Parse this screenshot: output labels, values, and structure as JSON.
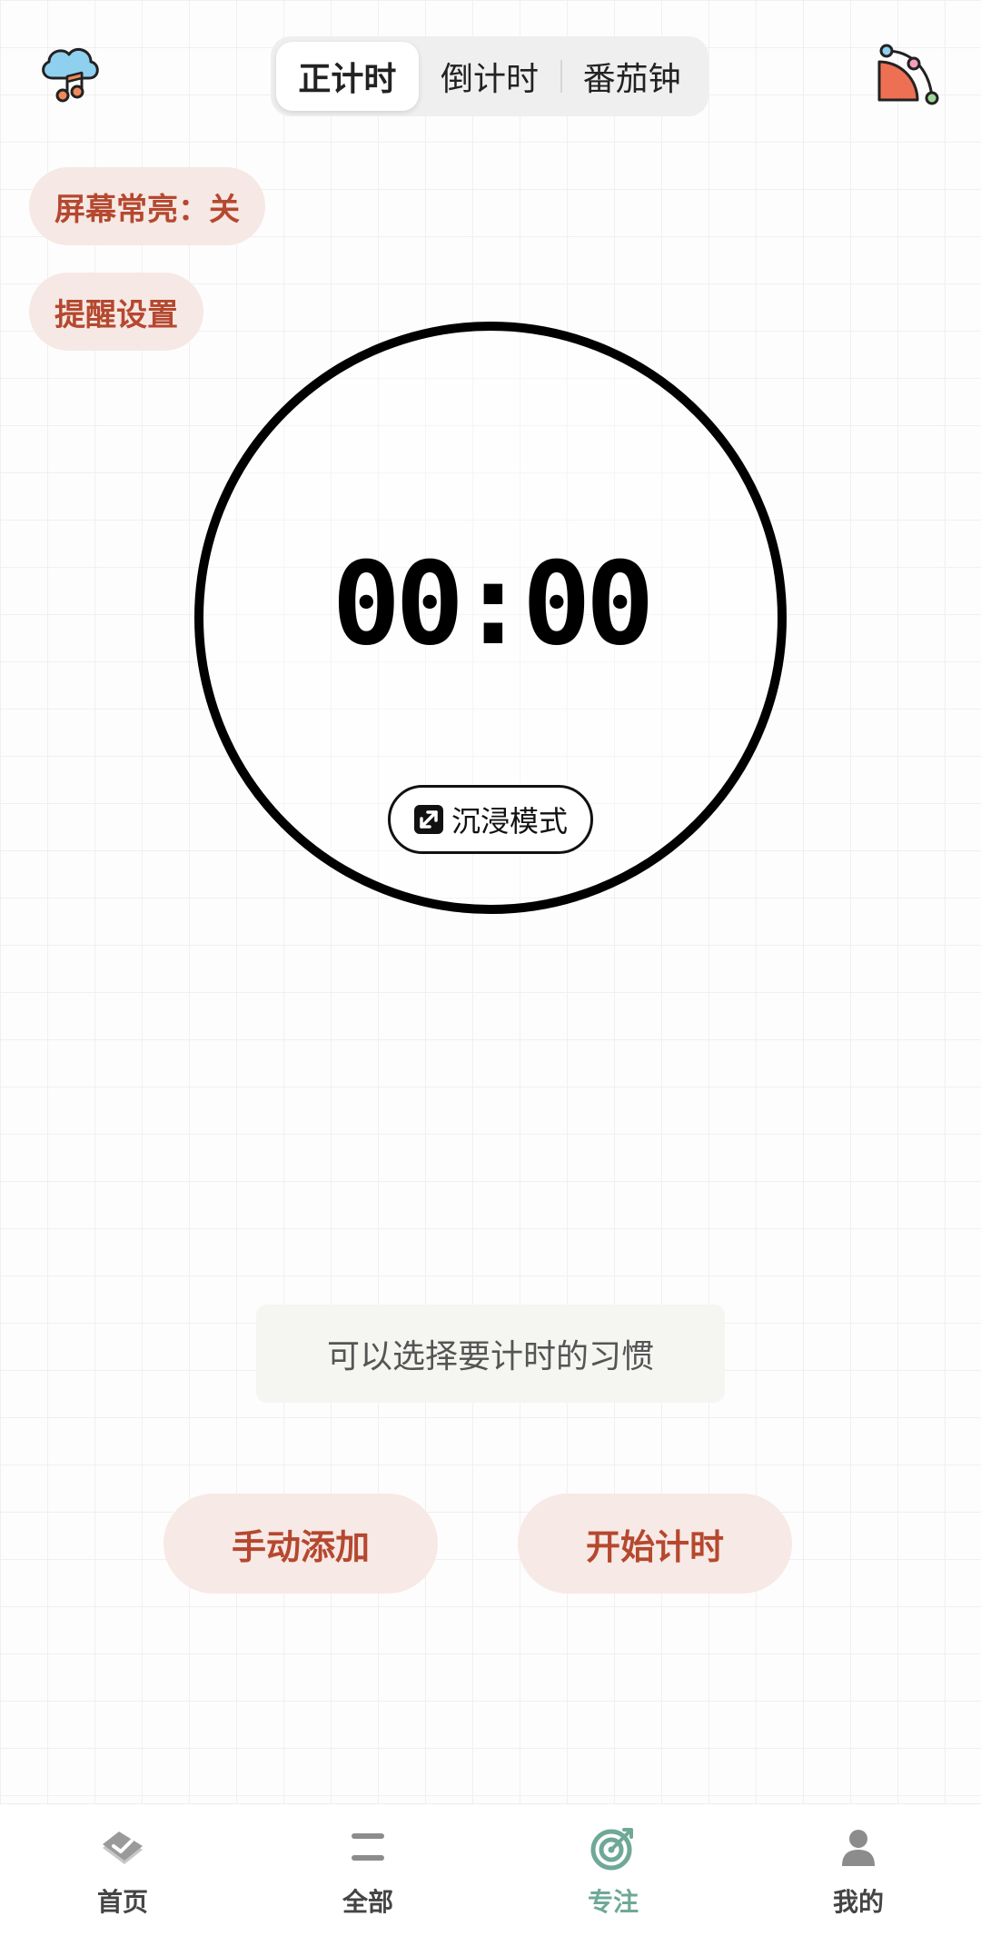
{
  "header": {
    "tabs": [
      {
        "label": "正计时",
        "active": true
      },
      {
        "label": "倒计时",
        "active": false
      },
      {
        "label": "番茄钟",
        "active": false
      }
    ]
  },
  "settings": {
    "screen_on_label": "屏幕常亮：关",
    "reminder_label": "提醒设置"
  },
  "timer": {
    "display": "00:00",
    "immersive_label": "沉浸模式"
  },
  "habit": {
    "placeholder": "可以选择要计时的习惯"
  },
  "actions": {
    "manual_add": "手动添加",
    "start": "开始计时"
  },
  "nav": {
    "items": [
      {
        "label": "首页",
        "icon": "home-check-icon",
        "active": false
      },
      {
        "label": "全部",
        "icon": "list-icon",
        "active": false
      },
      {
        "label": "专注",
        "icon": "target-icon",
        "active": true
      },
      {
        "label": "我的",
        "icon": "person-icon",
        "active": false
      }
    ]
  },
  "colors": {
    "accent_text": "#b5482f",
    "pill_bg": "#f6e8e4",
    "nav_active": "#6fa897"
  }
}
